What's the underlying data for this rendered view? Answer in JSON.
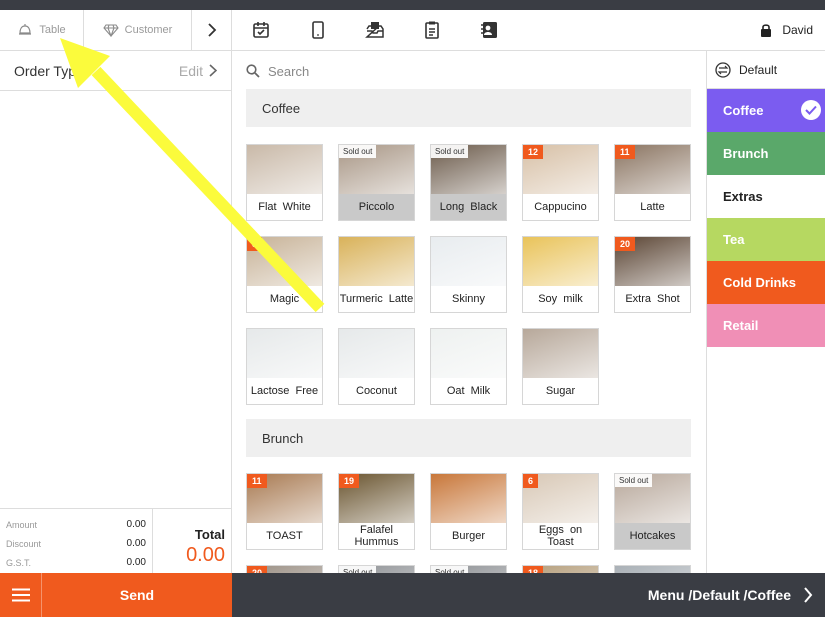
{
  "left_tabs": {
    "table": "Table",
    "customer": "Customer"
  },
  "order_type": {
    "label": "Order Type",
    "edit": "Edit"
  },
  "totals": {
    "rows": [
      {
        "label": "Amount",
        "value": "0.00"
      },
      {
        "label": "Discount",
        "value": "0.00"
      },
      {
        "label": "G.S.T.",
        "value": "0.00"
      }
    ],
    "total_label": "Total",
    "total_value": "0.00"
  },
  "toolbar": {
    "icons": [
      "calendar-check-icon",
      "tablet-icon",
      "cash-drawer-icon",
      "clipboard-icon",
      "contact-card-icon"
    ],
    "user": "David"
  },
  "search": {
    "placeholder": "Search"
  },
  "sections": [
    {
      "title": "Coffee",
      "items": [
        {
          "name": "Flat White",
          "badge": "",
          "sold_out": "",
          "color": "#c9b9a8"
        },
        {
          "name": "Piccolo",
          "badge": "",
          "sold_out": "Sold out",
          "color": "#a89685"
        },
        {
          "name": "Long Black",
          "badge": "",
          "sold_out": "Sold out",
          "color": "#6b5a4a"
        },
        {
          "name": "Cappucino",
          "badge": "12",
          "sold_out": "",
          "color": "#d7c0a6"
        },
        {
          "name": "Latte",
          "badge": "11",
          "sold_out": "",
          "color": "#8a7461"
        },
        {
          "name": "Magic",
          "badge": "5",
          "sold_out": "",
          "color": "#c7b297"
        },
        {
          "name": "Turmeric Latte",
          "badge": "",
          "sold_out": "",
          "color": "#d9b25a"
        },
        {
          "name": "Skinny",
          "badge": "",
          "sold_out": "",
          "color": "#e8ecef"
        },
        {
          "name": "Soy milk",
          "badge": "",
          "sold_out": "",
          "color": "#e9c35a"
        },
        {
          "name": "Extra Shot",
          "badge": "20",
          "sold_out": "",
          "color": "#5a4433"
        },
        {
          "name": "Lactose Free",
          "badge": "",
          "sold_out": "",
          "color": "#e6e9ea"
        },
        {
          "name": "Coconut",
          "badge": "",
          "sold_out": "",
          "color": "#e6e9ea"
        },
        {
          "name": "Oat Milk",
          "badge": "",
          "sold_out": "",
          "color": "#eef1f0"
        },
        {
          "name": "Sugar",
          "badge": "",
          "sold_out": "",
          "color": "#b7a89a"
        }
      ]
    },
    {
      "title": "Brunch",
      "items": [
        {
          "name": "TOAST",
          "badge": "11",
          "sold_out": "",
          "color": "#a87a52"
        },
        {
          "name": "Falafel Hummus",
          "badge": "19",
          "sold_out": "",
          "color": "#6a5530"
        },
        {
          "name": "Burger",
          "badge": "",
          "sold_out": "",
          "color": "#c8773a"
        },
        {
          "name": "Eggs on Toast",
          "badge": "6",
          "sold_out": "",
          "color": "#d8c8b6"
        },
        {
          "name": "Hotcakes",
          "badge": "",
          "sold_out": "Sold out",
          "color": "#b7a79a"
        },
        {
          "name": "",
          "badge": "20",
          "sold_out": "",
          "color": "#9a8f84"
        },
        {
          "name": "",
          "badge": "",
          "sold_out": "Sold out",
          "color": "#8c8f93"
        },
        {
          "name": "",
          "badge": "",
          "sold_out": "Sold out",
          "color": "#8c8f93"
        },
        {
          "name": "",
          "badge": "18",
          "sold_out": "",
          "color": "#b49d7a"
        },
        {
          "name": "",
          "badge": "",
          "sold_out": "",
          "color": "#a9b0b6"
        }
      ]
    }
  ],
  "categories": {
    "default_label": "Default",
    "items": [
      {
        "label": "Coffee",
        "color": "#7b5cf0",
        "text_color": "#ffffff",
        "selected": true
      },
      {
        "label": "Brunch",
        "color": "#5aa86a",
        "text_color": "#ffffff",
        "selected": false
      },
      {
        "label": "Extras",
        "color": "#ffffff",
        "text_color": "#222222",
        "selected": false
      },
      {
        "label": "Tea",
        "color": "#b6d861",
        "text_color": "#ffffff",
        "selected": false
      },
      {
        "label": "Cold Drinks",
        "color": "#f05a1e",
        "text_color": "#ffffff",
        "selected": false
      },
      {
        "label": "Retail",
        "color": "#f08fb6",
        "text_color": "#ffffff",
        "selected": false
      }
    ]
  },
  "bottom": {
    "send": "Send",
    "breadcrumb": "Menu /Default /Coffee"
  },
  "colors": {
    "accent": "#f05a1e",
    "dark": "#3a3d44",
    "annotation": "#fbfb3c"
  }
}
